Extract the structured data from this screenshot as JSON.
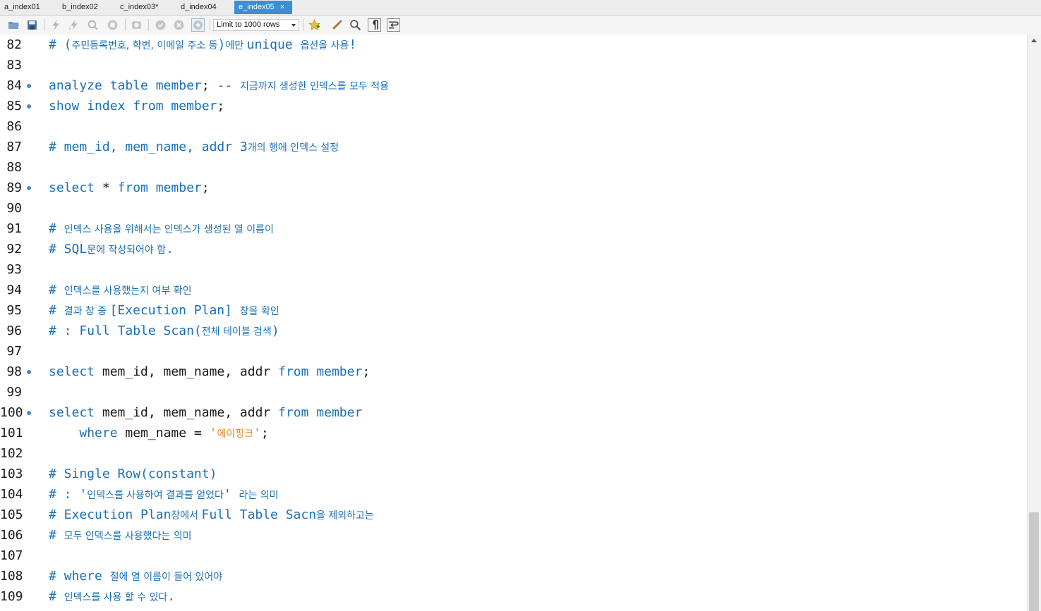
{
  "tabs": [
    {
      "label": "a_index01",
      "active": false
    },
    {
      "label": "b_index02",
      "active": false
    },
    {
      "label": "c_index03*",
      "active": false
    },
    {
      "label": "d_index04",
      "active": false
    },
    {
      "label": "e_index05",
      "active": true
    }
  ],
  "tab_close_glyph": "×",
  "toolbar": {
    "limit_rows_label": "Limit to 1000 rows",
    "icons": [
      "open-folder-icon",
      "save-icon",
      "execute-icon",
      "execute-current-icon",
      "explain-icon",
      "stop-icon",
      "toggle-continue-icon",
      "commit-icon",
      "rollback-icon",
      "autocommit-icon",
      "add-snippet-icon",
      "beautify-icon",
      "find-icon",
      "invisible-chars-icon",
      "wrap-icon"
    ]
  },
  "colors": {
    "keyword": "#1a6fb7",
    "comment": "#1a6fb7",
    "string": "#e38b20",
    "text": "#1a1a1a",
    "active_tab": "#3b8ed6"
  },
  "editor": {
    "lines": [
      {
        "num": "82",
        "dot": false,
        "tokens": [
          [
            "cm",
            "# ("
          ],
          [
            "ko",
            "주민등록번호, 학번, 이메일 주소 등"
          ],
          [
            "cm",
            ")"
          ],
          [
            "ko",
            "에만 "
          ],
          [
            "cm",
            "unique "
          ],
          [
            "ko",
            "옵션을 사용"
          ],
          [
            "cm",
            "!"
          ]
        ]
      },
      {
        "num": "83",
        "dot": false,
        "tokens": []
      },
      {
        "num": "84",
        "dot": true,
        "tokens": [
          [
            "kw",
            "analyze table member"
          ],
          [
            "tx",
            "; "
          ],
          [
            "cm",
            "-- "
          ],
          [
            "ko",
            "지금까지 생성한 인덱스를 모두 적용"
          ]
        ]
      },
      {
        "num": "85",
        "dot": true,
        "tokens": [
          [
            "kw",
            "show index from member"
          ],
          [
            "tx",
            ";"
          ]
        ]
      },
      {
        "num": "86",
        "dot": false,
        "tokens": []
      },
      {
        "num": "87",
        "dot": false,
        "tokens": [
          [
            "cm",
            "# mem_id, mem_name, addr 3"
          ],
          [
            "ko",
            "개의 행에 인덱스 설정"
          ]
        ]
      },
      {
        "num": "88",
        "dot": false,
        "tokens": []
      },
      {
        "num": "89",
        "dot": true,
        "tokens": [
          [
            "kw",
            "select "
          ],
          [
            "tx",
            "* "
          ],
          [
            "kw",
            "from member"
          ],
          [
            "tx",
            ";"
          ]
        ]
      },
      {
        "num": "90",
        "dot": false,
        "tokens": []
      },
      {
        "num": "91",
        "dot": false,
        "tokens": [
          [
            "cm",
            "# "
          ],
          [
            "ko",
            "인덱스 사용을 위해서는 인덱스가 생성된 열 이름이"
          ]
        ]
      },
      {
        "num": "92",
        "dot": false,
        "tokens": [
          [
            "cm",
            "# SQL"
          ],
          [
            "ko",
            "문에 작성되어야 함"
          ],
          [
            "cm",
            "."
          ]
        ]
      },
      {
        "num": "93",
        "dot": false,
        "tokens": []
      },
      {
        "num": "94",
        "dot": false,
        "tokens": [
          [
            "cm",
            "# "
          ],
          [
            "ko",
            "인덱스를 사용했는지 여부 확인"
          ]
        ]
      },
      {
        "num": "95",
        "dot": false,
        "tokens": [
          [
            "cm",
            "# "
          ],
          [
            "ko",
            "결과 창 중 "
          ],
          [
            "cm",
            "[Execution Plan] "
          ],
          [
            "ko",
            "창을 확인"
          ]
        ]
      },
      {
        "num": "96",
        "dot": false,
        "tokens": [
          [
            "cm",
            "# : Full Table Scan("
          ],
          [
            "ko",
            "전체 테이블 검색"
          ],
          [
            "cm",
            ")"
          ]
        ]
      },
      {
        "num": "97",
        "dot": false,
        "tokens": []
      },
      {
        "num": "98",
        "dot": true,
        "tokens": [
          [
            "kw",
            "select "
          ],
          [
            "tx",
            "mem_id, mem_name, addr "
          ],
          [
            "kw",
            "from member"
          ],
          [
            "tx",
            ";"
          ]
        ]
      },
      {
        "num": "99",
        "dot": false,
        "tokens": []
      },
      {
        "num": "100",
        "dot": true,
        "tokens": [
          [
            "kw",
            "select "
          ],
          [
            "tx",
            "mem_id, mem_name, addr "
          ],
          [
            "kw",
            "from member"
          ]
        ]
      },
      {
        "num": "101",
        "dot": false,
        "tokens": [
          [
            "tx",
            "    "
          ],
          [
            "kw",
            "where "
          ],
          [
            "tx",
            "mem_name = "
          ],
          [
            "st",
            "'"
          ],
          [
            "sk",
            "에이핑크"
          ],
          [
            "st",
            "'"
          ],
          [
            "tx",
            ";"
          ]
        ]
      },
      {
        "num": "102",
        "dot": false,
        "tokens": []
      },
      {
        "num": "103",
        "dot": false,
        "tokens": [
          [
            "cm",
            "# Single Row(constant)"
          ]
        ]
      },
      {
        "num": "104",
        "dot": false,
        "tokens": [
          [
            "cm",
            "# : '"
          ],
          [
            "ko",
            "인덱스를 사용하여 결과를 얻었다"
          ],
          [
            "cm",
            "' "
          ],
          [
            "ko",
            "라는 의미"
          ]
        ]
      },
      {
        "num": "105",
        "dot": false,
        "tokens": [
          [
            "cm",
            "# Execution Plan"
          ],
          [
            "ko",
            "창에서 "
          ],
          [
            "cm",
            "Full Table Sacn"
          ],
          [
            "ko",
            "을 제외하고는"
          ]
        ]
      },
      {
        "num": "106",
        "dot": false,
        "tokens": [
          [
            "cm",
            "# "
          ],
          [
            "ko",
            "모두 인덱스를 사용했다는 의미"
          ]
        ]
      },
      {
        "num": "107",
        "dot": false,
        "tokens": []
      },
      {
        "num": "108",
        "dot": false,
        "tokens": [
          [
            "cm",
            "# where "
          ],
          [
            "ko",
            "절에 열 이름이 들어 있어야"
          ]
        ]
      },
      {
        "num": "109",
        "dot": false,
        "tokens": [
          [
            "cm",
            "# "
          ],
          [
            "ko",
            "인덱스를 사용 할 수 있다"
          ],
          [
            "cm",
            "."
          ]
        ]
      }
    ]
  }
}
